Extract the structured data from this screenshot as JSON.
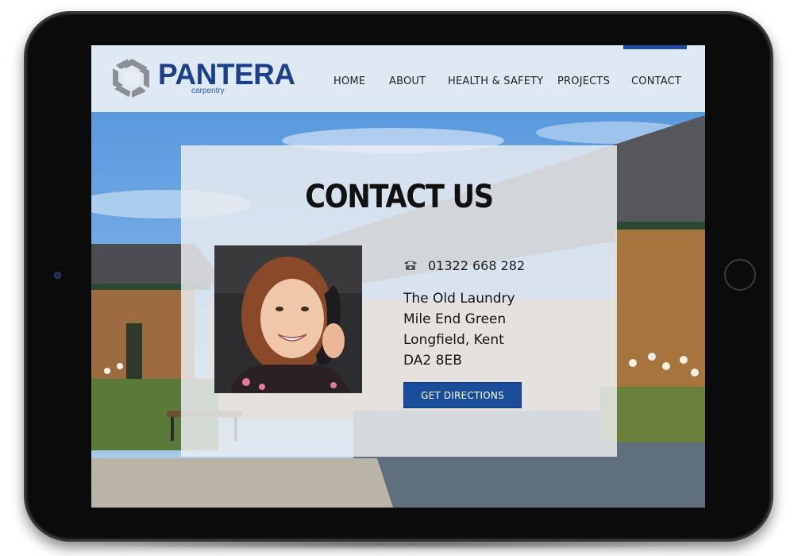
{
  "brand": {
    "name": "PANTERA",
    "tagline": "carpentry"
  },
  "nav": {
    "items": [
      {
        "label": "HOME"
      },
      {
        "label": "ABOUT"
      },
      {
        "label": "HEALTH & SAFETY"
      },
      {
        "label": "PROJECTS"
      },
      {
        "label": "CONTACT",
        "active": true
      }
    ]
  },
  "contact": {
    "title": "CONTACT US",
    "phone": "01322 668 282",
    "address": [
      "The Old Laundry",
      "Mile End Green",
      "Longfield, Kent",
      "DA2 8EB"
    ],
    "directions_label": "GET DIRECTIONS"
  },
  "icons": {
    "logo": "hexagon-logo-icon",
    "phone": "telephone-icon"
  },
  "colors": {
    "brand": "#1c3f8c",
    "button": "#1a4d9a",
    "nav_active": "#1c4da0",
    "logo_mark": "#8c8f94"
  }
}
